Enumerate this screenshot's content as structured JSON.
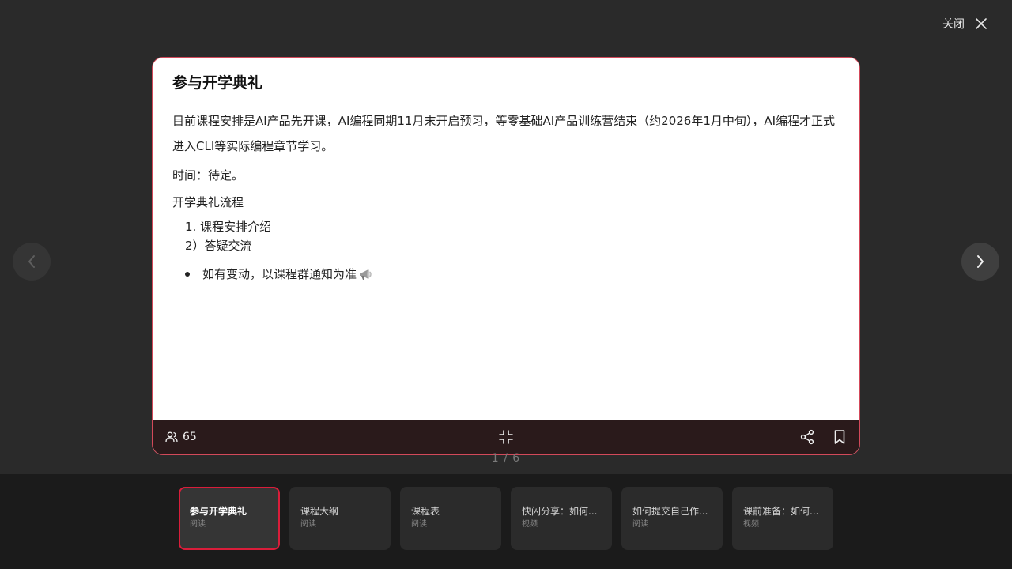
{
  "header": {
    "close_label": "关闭"
  },
  "card": {
    "title": "参与开学典礼",
    "paragraph1": "目前课程安排是AI产品先开课，AI编程同期11月末开启预习，等零基础AI产品训练营结束（约2026年1月中旬），AI编程才正式进入CLI等实际编程章节学习。",
    "time_line": "时间：待定。",
    "process_heading": "开学典礼流程",
    "list_items": [
      "1. 课程安排介绍",
      "2）答疑交流"
    ],
    "bullet": "如有变动，以课程群通知为准"
  },
  "footer": {
    "viewer_count": "65"
  },
  "pagination": {
    "indicator": "1 / 6"
  },
  "thumbnails": [
    {
      "title": "参与开学典礼",
      "type": "阅读",
      "active": true
    },
    {
      "title": "课程大纲",
      "type": "阅读"
    },
    {
      "title": "课程表",
      "type": "阅读"
    },
    {
      "title": "快闪分享：如何...",
      "type": "视频"
    },
    {
      "title": "如何提交自己作...",
      "type": "阅读"
    },
    {
      "title": "课前准备：如何...",
      "type": "视频"
    }
  ],
  "icons": {
    "close": "close-icon",
    "prev": "chevron-left-icon",
    "next": "chevron-right-icon",
    "viewers": "users-icon",
    "collapse": "collapse-icon",
    "share": "share-icon",
    "bookmark": "bookmark-icon",
    "megaphone": "megaphone-icon"
  },
  "colors": {
    "accent": "#d91d3a",
    "card_border": "#d3495a",
    "footer_bg": "#2a1a1b"
  }
}
